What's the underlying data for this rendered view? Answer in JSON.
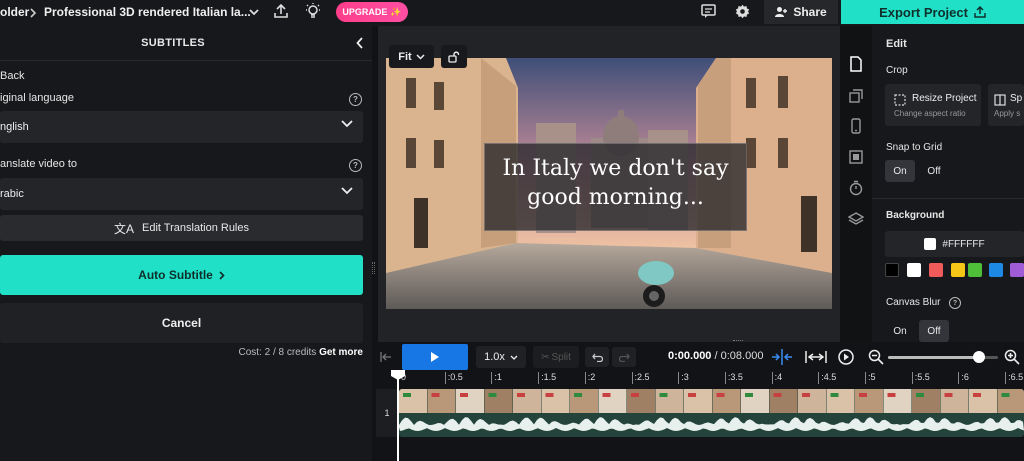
{
  "header": {
    "folder_label": "older",
    "project_title": "Professional 3D rendered Italian la...",
    "upgrade_label": "UPGRADE",
    "share_label": "Share",
    "export_label": "Export Project"
  },
  "subtitles_panel": {
    "title": "SUBTITLES",
    "back_label": "Back",
    "original_language_label": "iginal language",
    "original_language_value": "nglish",
    "translate_label": "anslate video to",
    "translate_value": "rabic",
    "edit_rules_label": "Edit Translation Rules",
    "auto_subtitle_label": "Auto Subtitle",
    "cancel_label": "Cancel",
    "cost_text": "Cost: 2 / 8 credits",
    "get_more_label": "Get more"
  },
  "canvas": {
    "fit_label": "Fit",
    "subtitle_line1": "In  Italy we don't say",
    "subtitle_line2": "good morning..."
  },
  "edit_panel": {
    "title": "Edit",
    "crop_label": "Crop",
    "resize_title": "Resize Project",
    "resize_sub": "Change aspect ratio",
    "split_title": "Sp",
    "split_sub": "Apply s",
    "snap_label": "Snap to Grid",
    "snap_on": "On",
    "snap_off": "Off",
    "background_label": "Background",
    "background_hex": "#FFFFFF",
    "swatches": [
      "#000000",
      "#ffffff",
      "#ef5a5a",
      "#f5c518",
      "#4fbf3a",
      "#1e88e5",
      "#a05bd6"
    ],
    "canvas_blur_label": "Canvas Blur",
    "blur_on": "On",
    "blur_off": "Off"
  },
  "timeline": {
    "speed": "1.0x",
    "split_label": "Split",
    "current_time": "0:00.000",
    "total_time": "/ 0:08.000",
    "track_number": "1",
    "zoom_level": 0.83,
    "ticks": [
      "0",
      ":0.5",
      ":1",
      ":1.5",
      ":2",
      ":2.5",
      ":3",
      ":3.5",
      ":4",
      ":4.5",
      ":5",
      ":5.5",
      ":6",
      ":6.5"
    ]
  }
}
